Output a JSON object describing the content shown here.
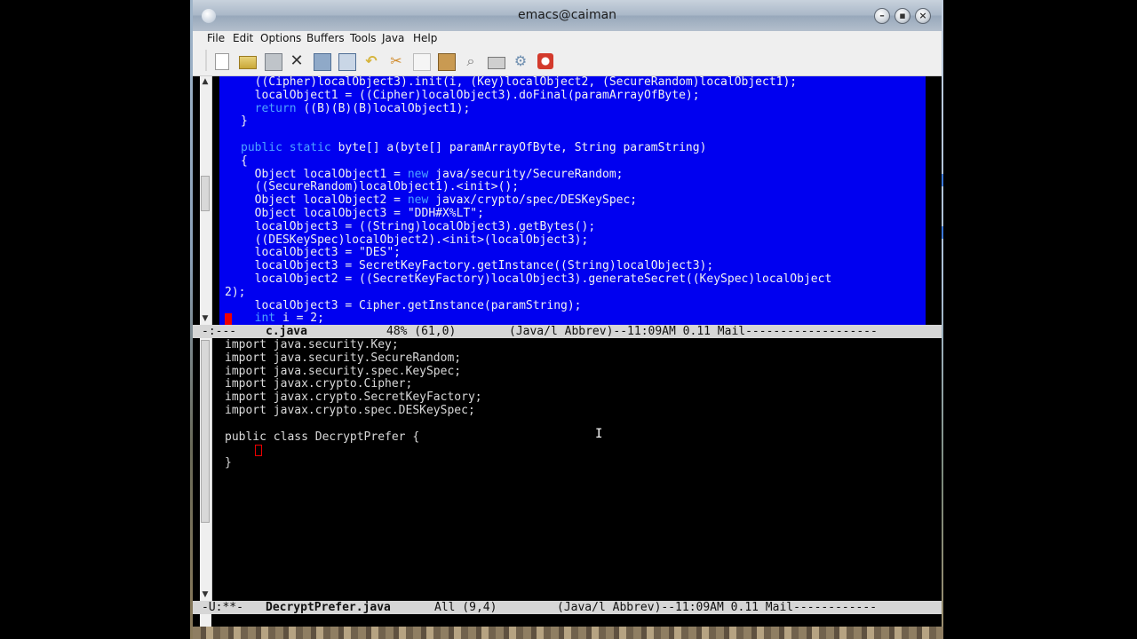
{
  "window": {
    "title": "emacs@caiman"
  },
  "menu": {
    "file": "File",
    "edit": "Edit",
    "options": "Options",
    "buffers": "Buffers",
    "tools": "Tools",
    "java": "Java",
    "help": "Help"
  },
  "toolbar": {
    "icons": [
      "new-file-icon",
      "open-folder-icon",
      "save-disabled-icon",
      "close-x-icon",
      "save-icon",
      "save-as-icon",
      "undo-icon",
      "cut-icon",
      "copy-icon",
      "paste-icon",
      "search-icon",
      "print-icon",
      "preferences-icon",
      "help-icon"
    ]
  },
  "top_buffer": {
    "lines": [
      "  ((Cipher)localObject3).init(i, (Key)localObject2, (SecureRandom)localObject1);",
      "  localObject1 = ((Cipher)localObject3).doFinal(paramArrayOfByte);",
      "  return ((B)(B)(B)localObject1);",
      "}",
      "",
      "public static byte[] a(byte[] paramArrayOfByte, String paramString)",
      "{",
      "  Object localObject1 = new java/security/SecureRandom;",
      "  ((SecureRandom)localObject1).<init>();",
      "  Object localObject2 = new javax/crypto/spec/DESKeySpec;",
      "  Object localObject3 = \"DDH#X%LT\";",
      "  localObject3 = ((String)localObject3).getBytes();",
      "  ((DESKeySpec)localObject2).<init>(localObject3);",
      "  localObject3 = \"DES\";",
      "  localObject3 = SecretKeyFactory.getInstance((String)localObject3);",
      "  localObject2 = ((SecretKeyFactory)localObject3).generateSecret((KeySpec)localObject",
      "2);",
      "  localObject3 = Cipher.getInstance(paramString);",
      "  int i = 2;"
    ]
  },
  "top_modeline": {
    "status": "-:---",
    "buffer": "c.java",
    "position": "48% (61,0)",
    "modes": "(Java/l Abbrev)--11:09AM 0.11 Mail-------------------"
  },
  "bottom_buffer": {
    "lines": [
      "import java.security.Key;",
      "import java.security.SecureRandom;",
      "import java.security.spec.KeySpec;",
      "import javax.crypto.Cipher;",
      "import javax.crypto.SecretKeyFactory;",
      "import javax.crypto.spec.DESKeySpec;",
      "",
      "public class DecryptPrefer {",
      "",
      "}"
    ]
  },
  "bottom_modeline": {
    "status": "-U:**-",
    "buffer": "DecryptPrefer.java",
    "position": "All (9,4)",
    "modes": "(Java/l Abbrev)--11:09AM 0.11 Mail------------"
  },
  "colors": {
    "region_highlight": "#0000f0",
    "keyword": "#4ea3ff",
    "cursor": "#e00000"
  }
}
